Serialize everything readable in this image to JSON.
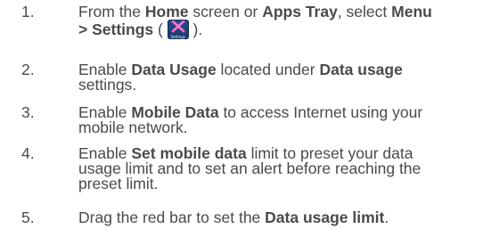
{
  "steps": [
    {
      "number": "1.",
      "parts": {
        "a": "From the ",
        "b": "Home",
        "c": " screen or ",
        "d": "Apps Tray",
        "e": ", select ",
        "f": "Menu",
        "g": "> Settings",
        "h": " ( ",
        "i": " )."
      },
      "icon": {
        "name": "settings-app-icon",
        "label": "Settings",
        "color": "#1f4f8c",
        "accent": "#e04bb5"
      }
    },
    {
      "number": "2.",
      "parts": {
        "a": "Enable ",
        "b": "Data Usage",
        "c": " located under ",
        "d": "Data usage",
        "e": "settings."
      }
    },
    {
      "number": "3.",
      "parts": {
        "a": "Enable ",
        "b": "Mobile Data",
        "c": " to access Internet using your",
        "d": "mobile network."
      }
    },
    {
      "number": "4.",
      "parts": {
        "a": "Enable ",
        "b": "Set mobile data",
        "c": " limit to preset your data",
        "d": "usage limit and to set an alert before reaching the",
        "e": "preset limit."
      }
    },
    {
      "number": "5.",
      "parts": {
        "a": "Drag the red bar to set the ",
        "b": "Data usage limit",
        "c": "."
      }
    }
  ]
}
